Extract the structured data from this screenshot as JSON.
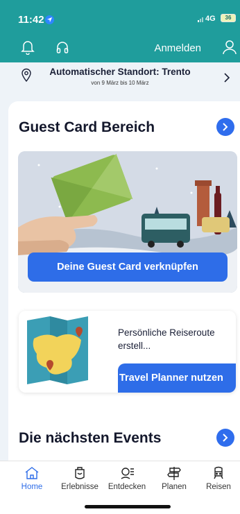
{
  "status_bar": {
    "time": "11:42",
    "network": "4G",
    "battery": "36"
  },
  "header": {
    "login_label": "Anmelden",
    "icons": [
      "bell-icon",
      "headphones-icon",
      "user-icon"
    ],
    "color": "#1f9d9c"
  },
  "location": {
    "title": "Automatischer Standort: Trento",
    "subtitle": "von 9 März bis 10 März"
  },
  "guest_card_section": {
    "title": "Guest Card Bereich",
    "button_label": "Deine Guest Card verknüpfen"
  },
  "planner": {
    "text": "Persönliche Reiseroute erstell...",
    "button_label": "Travel Planner nutzen"
  },
  "events_section": {
    "title": "Die nächsten Events"
  },
  "tabs": [
    {
      "label": "Home",
      "icon": "home-icon",
      "active": true
    },
    {
      "label": "Erlebnisse",
      "icon": "experiences-icon",
      "active": false
    },
    {
      "label": "Entdecken",
      "icon": "discover-icon",
      "active": false
    },
    {
      "label": "Planen",
      "icon": "signpost-icon",
      "active": false
    },
    {
      "label": "Reisen",
      "icon": "train-icon",
      "active": false
    }
  ],
  "colors": {
    "accent": "#2e6de8",
    "teal": "#1f9d9c",
    "background": "#eef3f8"
  }
}
